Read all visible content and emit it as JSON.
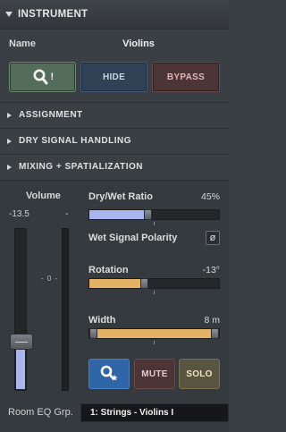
{
  "header": {
    "title": "INSTRUMENT",
    "icon": "triangle-down-icon"
  },
  "name_row": {
    "label": "Name",
    "value": "Violins"
  },
  "buttons": {
    "search_icon": "search-exclamation-icon",
    "search_suffix": "!",
    "hide": "HIDE",
    "bypass": "BYPASS"
  },
  "sections": [
    {
      "label": "ASSIGNMENT"
    },
    {
      "label": "DRY SIGNAL HANDLING"
    },
    {
      "label": "MIXING + SPATIALIZATION"
    }
  ],
  "volume": {
    "label": "Volume",
    "value": "-13.5",
    "meter_value": "-",
    "zero_mark": "- 0 -",
    "level": 0.3
  },
  "dry_wet": {
    "label": "Dry/Wet Ratio",
    "value": "45%",
    "level": 0.45,
    "color": "#a9b6ee"
  },
  "polarity": {
    "label": "Wet Signal Polarity",
    "symbol": "ø"
  },
  "rotation": {
    "label": "Rotation",
    "value": "-13°",
    "level": 0.42,
    "color": "#e4b265"
  },
  "width": {
    "label": "Width",
    "value": "8 m",
    "level": 1.0,
    "color": "#e4b265"
  },
  "actions": {
    "spatial_icon": "spatial-locate-icon",
    "mute": "MUTE",
    "solo": "SOLO"
  },
  "room_eq": {
    "label": "Room EQ Grp.",
    "value": "1: Strings - Violins I"
  },
  "colors": {
    "accent_blue": "#2f66a7",
    "mute": "#4c3535",
    "solo": "#5a5540",
    "hide": "#2f4256",
    "search": "#546c5a"
  }
}
